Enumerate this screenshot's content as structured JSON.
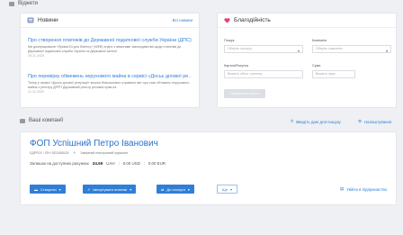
{
  "top_section": {
    "title": "Віджети"
  },
  "news": {
    "title": "Новини",
    "all_link": "Всі новини",
    "items": [
      {
        "title": "Про створення платежів до Державної податкової служби України (ДПС)",
        "text": "Ми доопрацювали «Приват24 для бізнесу» (WEB) згідно з вимогами законодавства щодо платежів до Державної податкової служби України та Державної митної",
        "date": "25.11.2025"
      },
      {
        "title": "Про перевірку обмежень нерухомого майна в сервісі «Досьє ділової ре…",
        "text": "Тепер у сервісі «Досьє ділової репутації» можна безкоштовно отримати звіт про стан обтяжень нерухомого майна з реєстру ДРРП Державний реєстр речових прав на",
        "date": "21.11.2025"
      }
    ]
  },
  "charity": {
    "title": "Благодійність",
    "labels": {
      "search": "Пошук",
      "company": "Компанія",
      "card": "Картка/Рахунок",
      "sum": "Сума"
    },
    "placeholders": {
      "search": "Оберіть послугу",
      "company": "Оберіть компанію",
      "card": "Вкажіть об'єкт платежу",
      "sum": "Вкажіть суму"
    },
    "submit": "Переказати кошти"
  },
  "companies": {
    "title": "Ваші компанії",
    "add_link": "Введіть дані для пошуку",
    "settings_link": "Налаштування"
  },
  "company": {
    "name": "ФОП Успішний Петро Іванович",
    "ids": "ЄДРПОУ / ІПН: 5874365424",
    "doc": "Завірений електронний підписант",
    "balance_label": "Залишок на доступних рахунках",
    "balance_uah": "34.69",
    "cur_uah": "UAH",
    "balance_usd": "0.00 USD",
    "balance_eur": "0.00 EUR",
    "buttons": {
      "create": "Створити",
      "import": "Імпортувати платежі",
      "services": "До послуги",
      "more": "Ще"
    },
    "enter_link": "Увійти в підприємство"
  }
}
